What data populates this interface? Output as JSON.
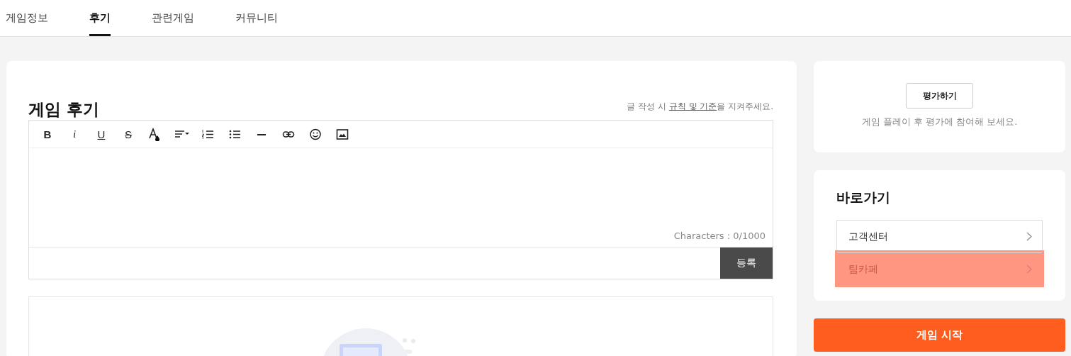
{
  "tabs": [
    {
      "label": "게임정보",
      "selected": false
    },
    {
      "label": "후기",
      "selected": true
    },
    {
      "label": "관련게임",
      "selected": false
    },
    {
      "label": "커뮤니티",
      "selected": false
    }
  ],
  "review": {
    "title": "게임 후기",
    "notice": {
      "before": "글 작성 시 ",
      "link": "규칙 및 기준",
      "after": "을 지켜주세요."
    },
    "toolbar": [
      {
        "kind": "bold",
        "label": "B"
      },
      {
        "kind": "italic",
        "label": "i"
      },
      {
        "kind": "underline",
        "label": "U"
      },
      {
        "kind": "strike",
        "label": "S"
      },
      {
        "kind": "color"
      },
      {
        "kind": "align"
      },
      {
        "kind": "ordered"
      },
      {
        "kind": "bullet"
      },
      {
        "kind": "rule"
      },
      {
        "kind": "link"
      },
      {
        "kind": "emoji"
      },
      {
        "kind": "image"
      }
    ],
    "counter": "Characters : 0/1000",
    "submit": "등록"
  },
  "rating": {
    "button": "평가하기",
    "hint": "게임 플레이 후 평가에 참여해 보세요."
  },
  "shortcuts": {
    "title": "바로가기",
    "items": [
      {
        "label": "고객센터",
        "highlighted": false
      },
      {
        "label": "팀카페",
        "highlighted": true
      }
    ]
  },
  "start_button": "게임 시작"
}
